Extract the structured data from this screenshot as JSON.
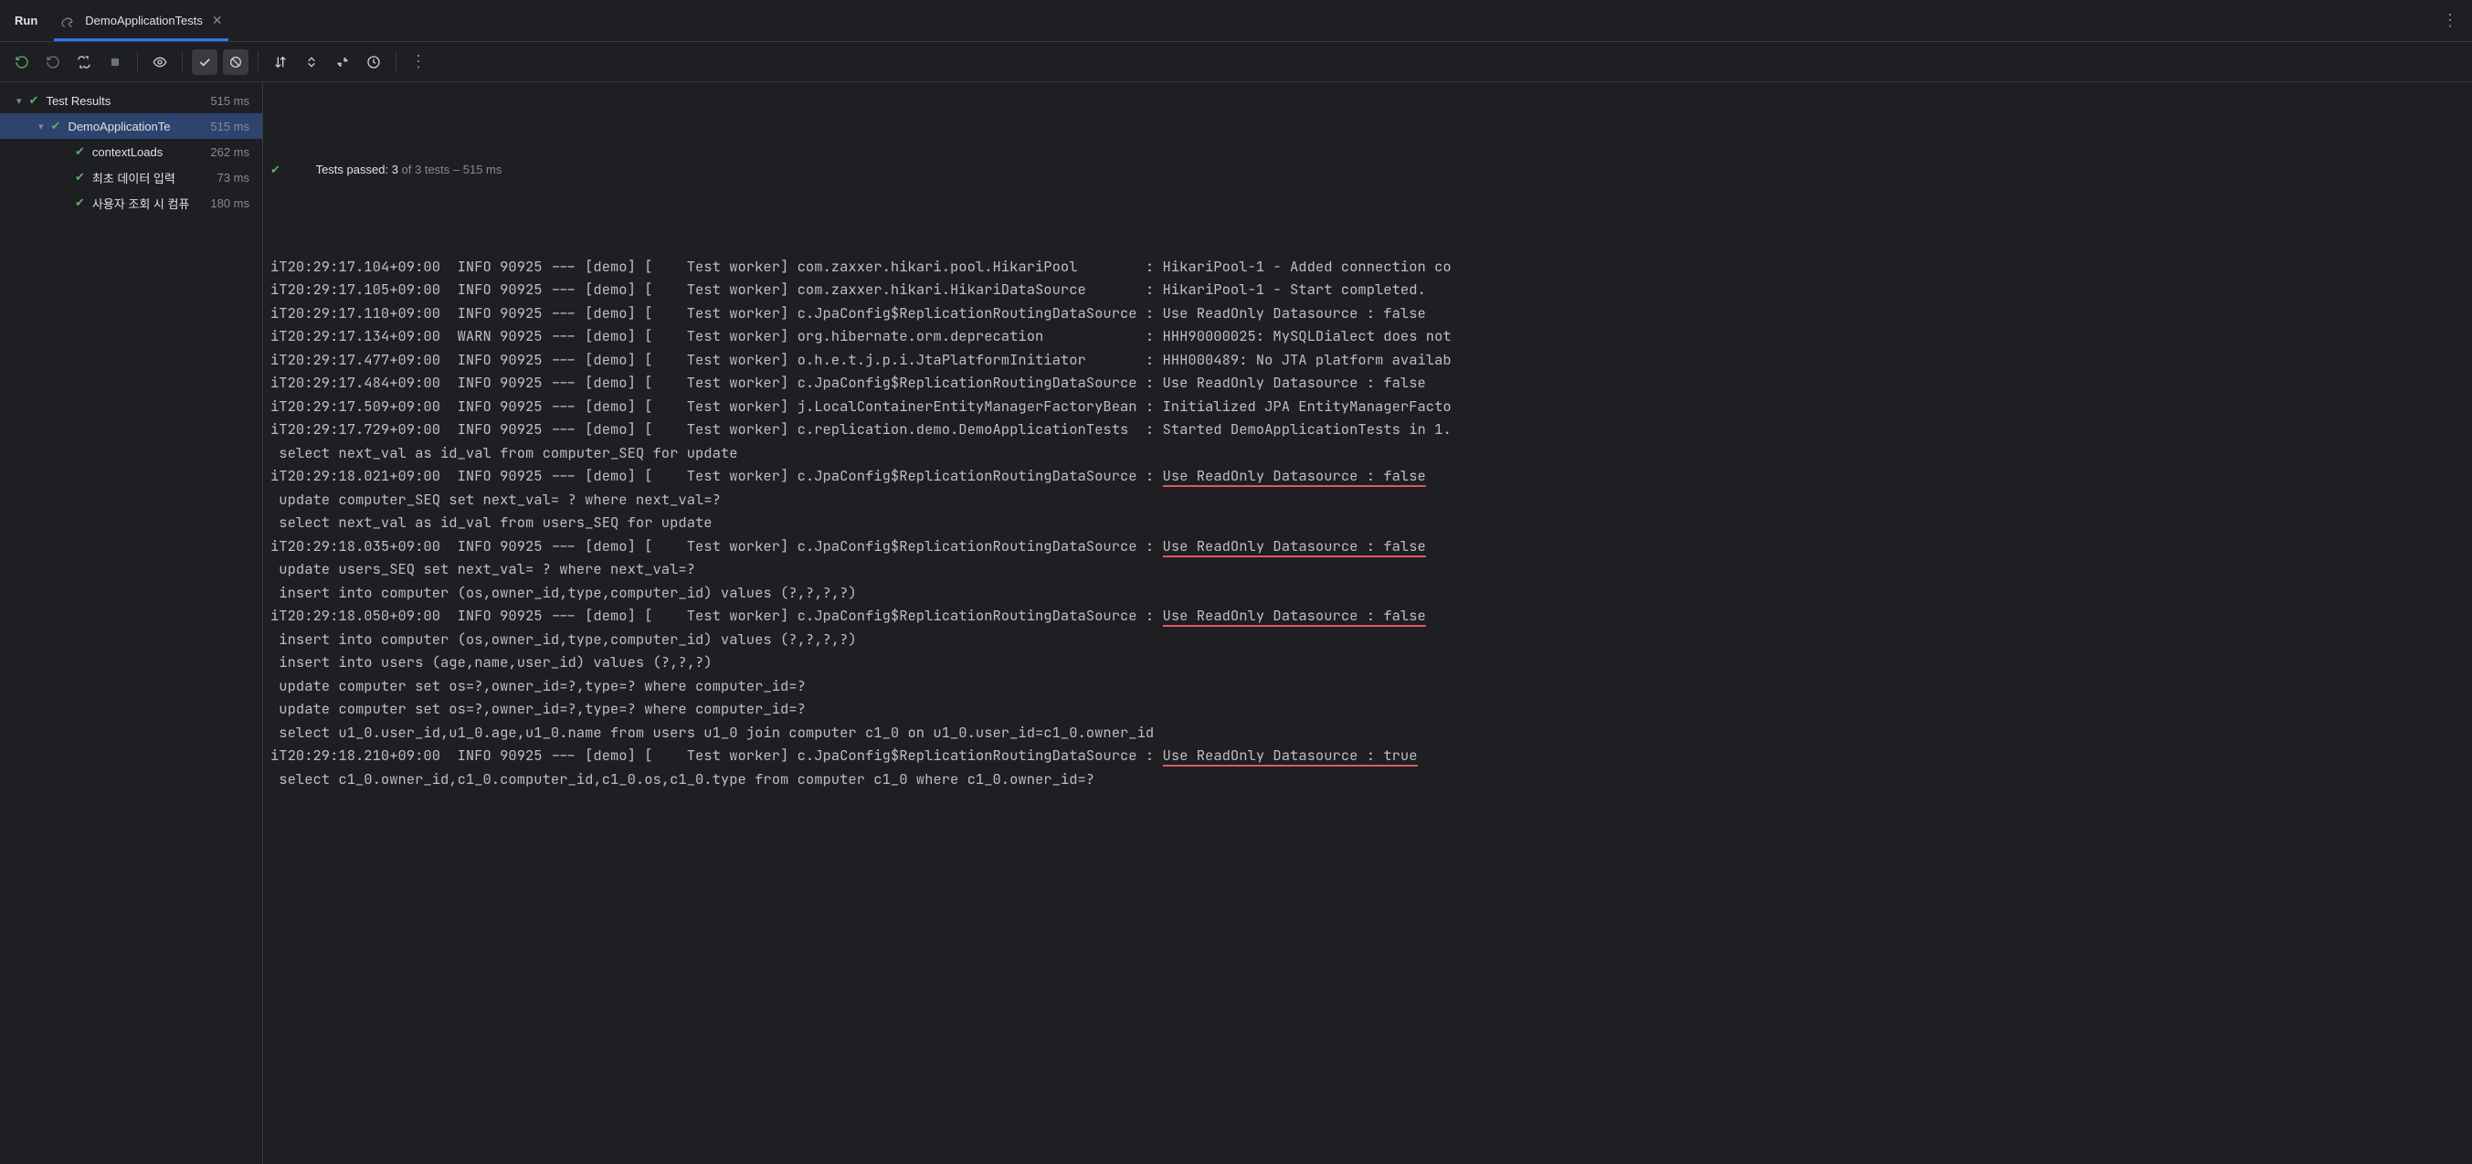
{
  "tabs": {
    "run_label": "Run",
    "test_tab": "DemoApplicationTests"
  },
  "status": {
    "prefix": "Tests passed: ",
    "passed": "3",
    "suffix": " of 3 tests – 515 ms"
  },
  "tree": {
    "root_label": "Test Results",
    "root_time": "515 ms",
    "class_label": "DemoApplicationTe",
    "class_time": "515 ms",
    "tests": [
      {
        "label": "contextLoads",
        "time": "262 ms"
      },
      {
        "label": "최초 데이터 입력",
        "time": "73 ms"
      },
      {
        "label": "사용자 조회 시 컴퓨",
        "time": "180 ms"
      }
    ]
  },
  "log": {
    "lines": [
      "iT20:29:17.104+09:00  INFO 90925 --- [demo] [    Test worker] com.zaxxer.hikari.pool.HikariPool        : HikariPool-1 - Added connection co",
      "iT20:29:17.105+09:00  INFO 90925 --- [demo] [    Test worker] com.zaxxer.hikari.HikariDataSource       : HikariPool-1 - Start completed.",
      "iT20:29:17.110+09:00  INFO 90925 --- [demo] [    Test worker] c.JpaConfig$ReplicationRoutingDataSource : Use ReadOnly Datasource : false",
      "iT20:29:17.134+09:00  WARN 90925 --- [demo] [    Test worker] org.hibernate.orm.deprecation            : HHH90000025: MySQLDialect does not",
      "iT20:29:17.477+09:00  INFO 90925 --- [demo] [    Test worker] o.h.e.t.j.p.i.JtaPlatformInitiator       : HHH000489: No JTA platform availab",
      "iT20:29:17.484+09:00  INFO 90925 --- [demo] [    Test worker] c.JpaConfig$ReplicationRoutingDataSource : Use ReadOnly Datasource : false",
      "iT20:29:17.509+09:00  INFO 90925 --- [demo] [    Test worker] j.LocalContainerEntityManagerFactoryBean : Initialized JPA EntityManagerFacto",
      "iT20:29:17.729+09:00  INFO 90925 --- [demo] [    Test worker] c.replication.demo.DemoApplicationTests  : Started DemoApplicationTests in 1.",
      " select next_val as id_val from computer_SEQ for update",
      "iT20:29:18.021+09:00  INFO 90925 --- [demo] [    Test worker] c.JpaConfig$ReplicationRoutingDataSource : ",
      " update computer_SEQ set next_val= ? where next_val=?",
      " select next_val as id_val from users_SEQ for update",
      "iT20:29:18.035+09:00  INFO 90925 --- [demo] [    Test worker] c.JpaConfig$ReplicationRoutingDataSource : ",
      " update users_SEQ set next_val= ? where next_val=?",
      " insert into computer (os,owner_id,type,computer_id) values (?,?,?,?)",
      "iT20:29:18.050+09:00  INFO 90925 --- [demo] [    Test worker] c.JpaConfig$ReplicationRoutingDataSource : ",
      " insert into computer (os,owner_id,type,computer_id) values (?,?,?,?)",
      " insert into users (age,name,user_id) values (?,?,?)",
      " update computer set os=?,owner_id=?,type=? where computer_id=?",
      " update computer set os=?,owner_id=?,type=? where computer_id=?",
      " select u1_0.user_id,u1_0.age,u1_0.name from users u1_0 join computer c1_0 on u1_0.user_id=c1_0.owner_id",
      "iT20:29:18.210+09:00  INFO 90925 --- [demo] [    Test worker] c.JpaConfig$ReplicationRoutingDataSource : ",
      " select c1_0.owner_id,c1_0.computer_id,c1_0.os,c1_0.type from computer c1_0 where c1_0.owner_id=?"
    ],
    "highlights": {
      "9": "Use ReadOnly Datasource : false",
      "12": "Use ReadOnly Datasource : false",
      "15": "Use ReadOnly Datasource : false",
      "21": "Use ReadOnly Datasource : true"
    }
  }
}
